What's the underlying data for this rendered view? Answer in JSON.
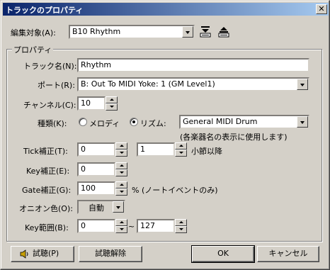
{
  "window": {
    "title": "トラックのプロパティ",
    "close_glyph": "✕"
  },
  "target": {
    "label": "編集対象(A):",
    "value": "B10 Rhythm",
    "icons": [
      "move-down-icon",
      "move-up-icon"
    ]
  },
  "group_label": "プロパティ",
  "track_name": {
    "label": "トラック名(N):",
    "value": "Rhythm"
  },
  "port": {
    "label": "ポート(R):",
    "value": "B: Out To MIDI Yoke: 1 (GM Level1)"
  },
  "channel": {
    "label": "チャンネル(C):",
    "value": "10"
  },
  "kind": {
    "label": "種類(K):",
    "melody_label": "メロディ",
    "rhythm_label": "リズム:",
    "selected": "rhythm",
    "rhythm_value": "General MIDI Drum",
    "note": "(各楽器名の表示に使用します)"
  },
  "tick": {
    "label": "Tick補正(T):",
    "value": "0",
    "measure_value": "1",
    "measure_suffix": "小節以降"
  },
  "key": {
    "label": "Key補正(E):",
    "value": "0"
  },
  "gate": {
    "label": "Gate補正(G):",
    "value": "100",
    "suffix": "% (ノートイベントのみ)"
  },
  "onion": {
    "label": "オニオン色(O):",
    "value": "自動"
  },
  "key_range": {
    "label": "Key範囲(B):",
    "from": "0",
    "separator": "~",
    "to": "127"
  },
  "buttons": {
    "audition": "試聴(P)",
    "audition_release": "試聴解除",
    "ok": "OK",
    "cancel": "キャンセル"
  }
}
